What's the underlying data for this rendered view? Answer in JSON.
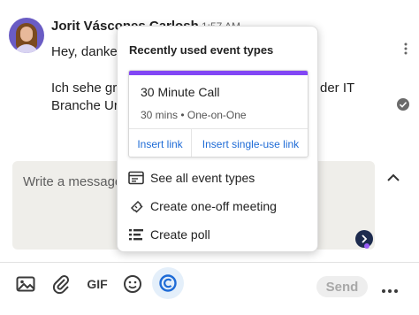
{
  "message": {
    "sender": "Jorit Váscones Carlosh",
    "timestamp": "1:57 AM",
    "line1_left": "Hey, danke",
    "line2_left": "Ich sehe gr",
    "line2_right": "der IT",
    "line3_left": "Branche Ur"
  },
  "composer": {
    "placeholder": "Write a message…"
  },
  "toolbar": {
    "gif_label": "GIF",
    "send_label": "Send"
  },
  "popover": {
    "title": "Recently used event types",
    "event": {
      "name": "30 Minute Call",
      "meta": "30 mins • One-on-One",
      "accent_color": "#8247f5",
      "insert_link": "Insert link",
      "insert_single_use_link": "Insert single-use link"
    },
    "menu": [
      {
        "label": "See all event types",
        "icon": "event-types-icon"
      },
      {
        "label": "Create one-off meeting",
        "icon": "ticket-icon"
      },
      {
        "label": "Create poll",
        "icon": "poll-icon"
      }
    ]
  },
  "colors": {
    "link": "#1e6bd6",
    "composer_bg": "#efeeea",
    "calendly_tool_bg": "#e4effa"
  }
}
